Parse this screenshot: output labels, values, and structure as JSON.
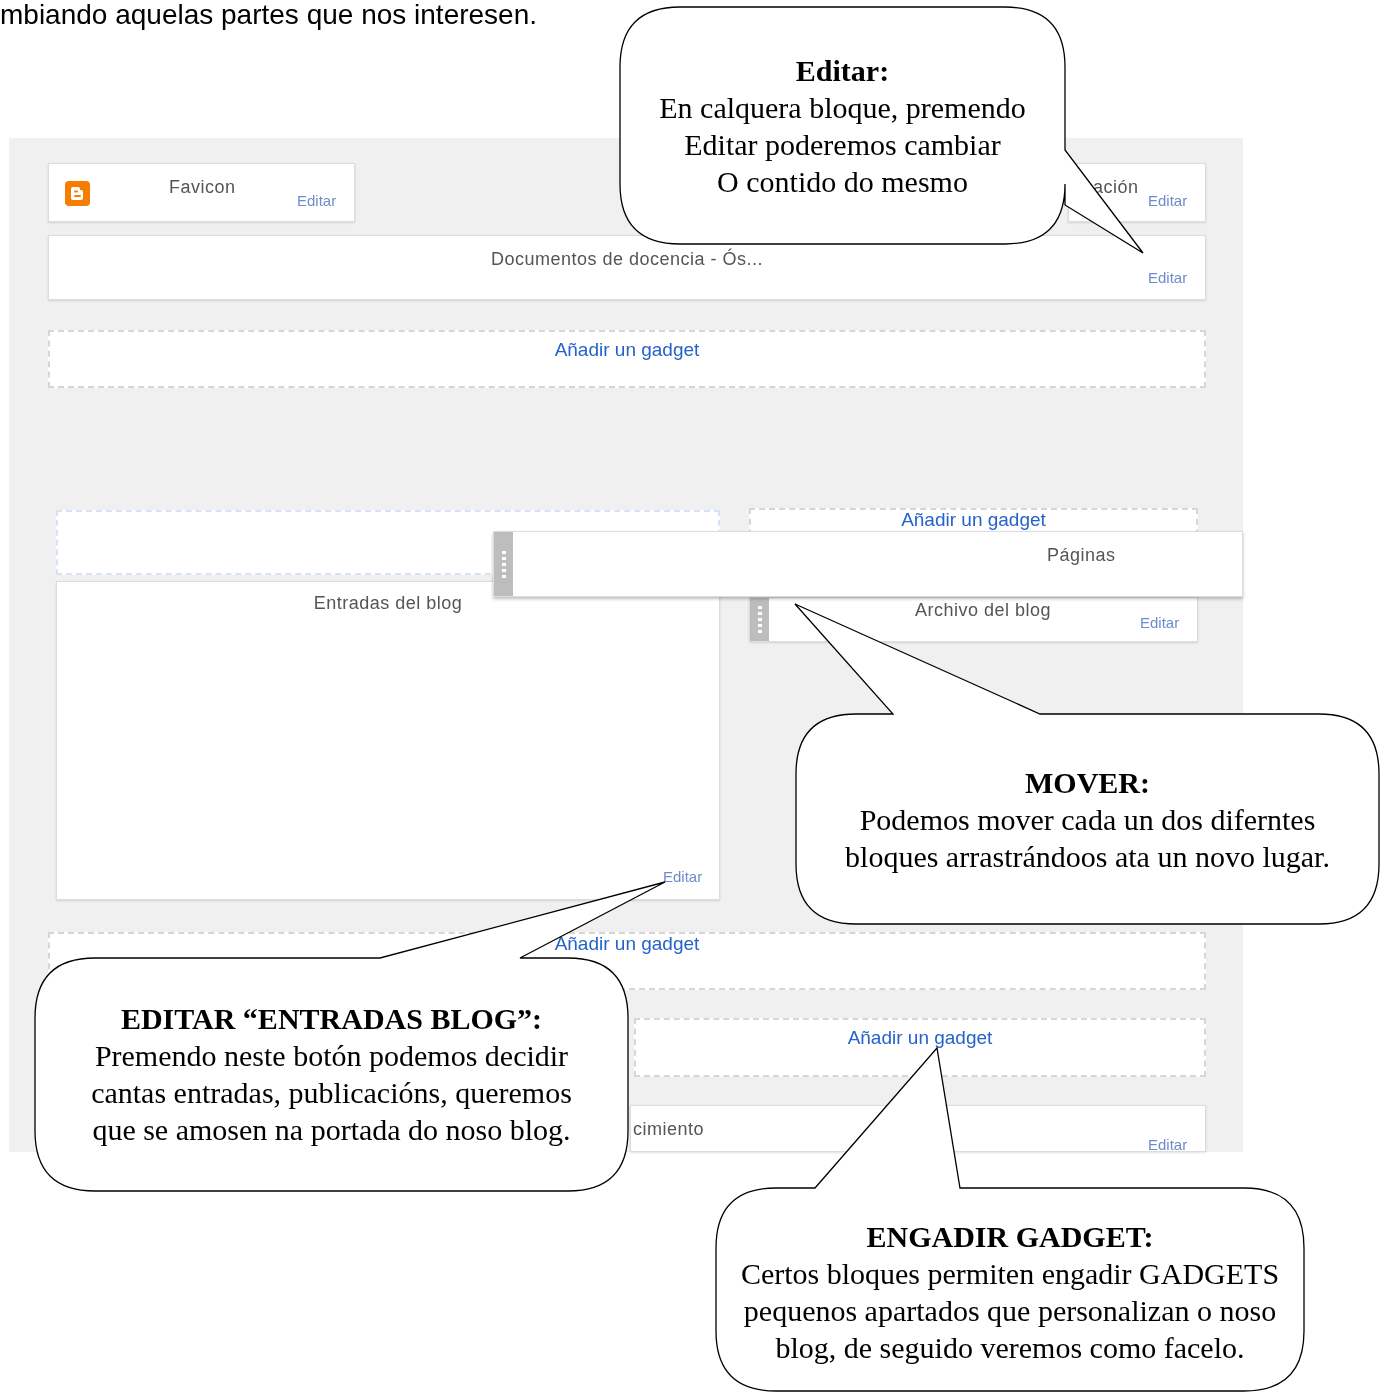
{
  "intro_text": "mbiando aquelas partes que nos interesen.",
  "layout_widgets": [
    {
      "kind": "gadget",
      "title": "Favicon",
      "edit_link": "Editar"
    },
    {
      "kind": "gadget",
      "title": "ación",
      "edit_link": "Editar"
    },
    {
      "kind": "gadget",
      "title": "Documentos de docencia - Ós...",
      "edit_link": "Editar"
    },
    {
      "kind": "add_gadget",
      "link": "Añadir un gadget"
    },
    {
      "kind": "drop_zone"
    },
    {
      "kind": "gadget",
      "title": "Entradas del blog",
      "edit_link": "Editar"
    },
    {
      "kind": "add_gadget",
      "link": "Añadir un gadget"
    },
    {
      "kind": "gadget",
      "title": "Páginas",
      "handle": true
    },
    {
      "kind": "gadget",
      "title": "Archivo del blog",
      "edit_link": "Editar",
      "handle": true
    },
    {
      "kind": "add_gadget",
      "link": "Añadir un gadget"
    },
    {
      "kind": "add_gadget",
      "link": "Añadir un gadget"
    },
    {
      "kind": "gadget",
      "title": "cimiento",
      "edit_link": "Editar"
    }
  ],
  "callouts": [
    {
      "title": "Editar:",
      "lines": [
        "En calquera bloque, premendo",
        "Editar poderemos cambiar",
        "O contido do mesmo"
      ]
    },
    {
      "title": "MOVER:",
      "lines": [
        "Podemos mover cada un dos diferntes",
        "bloques arrastrándoos ata un novo lugar."
      ]
    },
    {
      "title": "EDITAR “ENTRADAS BLOG”:",
      "lines": [
        "Premendo neste botón podemos decidir",
        "cantas entradas, publicacións, queremos",
        "que se amosen na portada do noso blog."
      ]
    },
    {
      "title": "ENGADIR GADGET:",
      "lines": [
        "Certos bloques permiten engadir GADGETS",
        "pequenos apartados que personalizan o noso",
        "blog, de seguido veremos como facelo."
      ]
    }
  ]
}
